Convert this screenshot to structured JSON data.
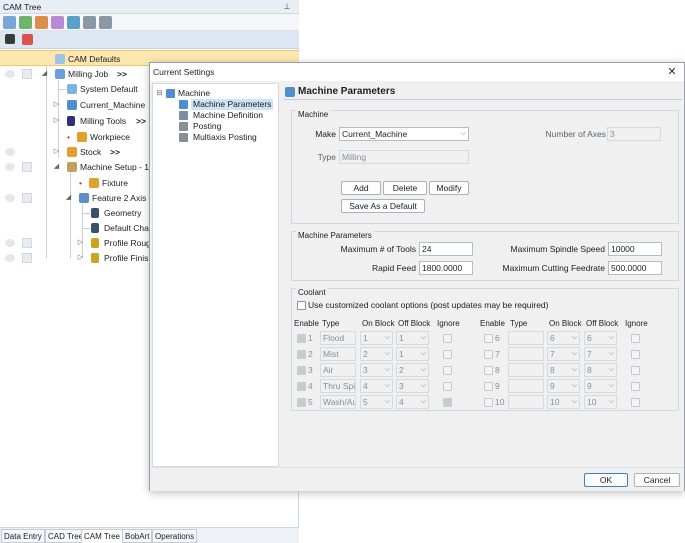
{
  "cam_panel": {
    "title": "CAM Tree",
    "pin": "⊥",
    "tree": [
      {
        "label": "CAM Defaults",
        "icon": "folder-icon"
      },
      {
        "label": "Milling Job",
        "suffix": ">>",
        "icon": "job-icon"
      },
      {
        "label": "System Default",
        "icon": "system-icon"
      },
      {
        "label": "Current_Machine",
        "icon": "machine-icon"
      },
      {
        "label": "Milling Tools",
        "suffix": ">>",
        "icon": "tool-icon"
      },
      {
        "label": "Workpiece",
        "icon": "workpiece-icon"
      },
      {
        "label": "Stock",
        "suffix": ">>",
        "icon": "stock-icon"
      },
      {
        "label": "Machine Setup - 1",
        "icon": "setup-icon"
      },
      {
        "label": "Fixture",
        "icon": "fixture-icon"
      },
      {
        "label": "Feature 2 Axis",
        "icon": "feature-icon"
      },
      {
        "label": "Geometry",
        "icon": "geometry-icon"
      },
      {
        "label": "Default Chain",
        "icon": "chain-icon"
      },
      {
        "label": "Profile Rough",
        "icon": "profile-icon"
      },
      {
        "label": "Profile Finish",
        "icon": "profile-icon"
      }
    ],
    "bottom_tabs": [
      "Data Entry",
      "CAD Tree",
      "CAM Tree",
      "BobArt",
      "Operations"
    ]
  },
  "dialog": {
    "title": "Current Settings",
    "close": "✕",
    "nav": {
      "root": "Machine",
      "items": [
        "Machine Parameters",
        "Machine Definition",
        "Posting",
        "Multiaxis Posting"
      ]
    },
    "header": "Machine Parameters",
    "machine_group": {
      "legend": "Machine",
      "make_label": "Make",
      "make_value": "Current_Machine",
      "type_label": "Type",
      "type_value": "Milling",
      "axes_label": "Number of Axes",
      "axes_value": "3",
      "add": "Add",
      "delete": "Delete",
      "modify": "Modify",
      "save_default": "Save As a Default"
    },
    "params_group": {
      "legend": "Machine Parameters",
      "max_tools_label": "Maximum # of Tools",
      "max_tools": "24",
      "max_spindle_label": "Maximum Spindle Speed",
      "max_spindle": "10000",
      "rapid_label": "Rapid Feed",
      "rapid": "1800.0000",
      "max_cut_label": "Maximum Cutting Feedrate",
      "max_cut": "500.0000"
    },
    "coolant_group": {
      "legend": "Coolant",
      "custom_option": "Use customized coolant options (post updates may be required)",
      "headers": [
        "Enable",
        "Type",
        "On Block",
        "Off Block",
        "Ignore"
      ],
      "left_rows": [
        {
          "num": "1",
          "type": "Flood",
          "on": "1",
          "off": "1",
          "ignore": false
        },
        {
          "num": "2",
          "type": "Mist",
          "on": "2",
          "off": "1",
          "ignore": false
        },
        {
          "num": "3",
          "type": "Air",
          "on": "3",
          "off": "2",
          "ignore": false
        },
        {
          "num": "4",
          "type": "Thru Spindle",
          "on": "4",
          "off": "3",
          "ignore": false
        },
        {
          "num": "5",
          "type": "Wash/Auger",
          "on": "5",
          "off": "4",
          "ignore": true
        }
      ],
      "right_rows": [
        {
          "num": "6",
          "type": "",
          "on": "6",
          "off": "6"
        },
        {
          "num": "7",
          "type": "",
          "on": "7",
          "off": "7"
        },
        {
          "num": "8",
          "type": "",
          "on": "8",
          "off": "8"
        },
        {
          "num": "9",
          "type": "",
          "on": "9",
          "off": "9"
        },
        {
          "num": "10",
          "type": "",
          "on": "10",
          "off": "10"
        }
      ]
    },
    "ok": "OK",
    "cancel": "Cancel"
  }
}
